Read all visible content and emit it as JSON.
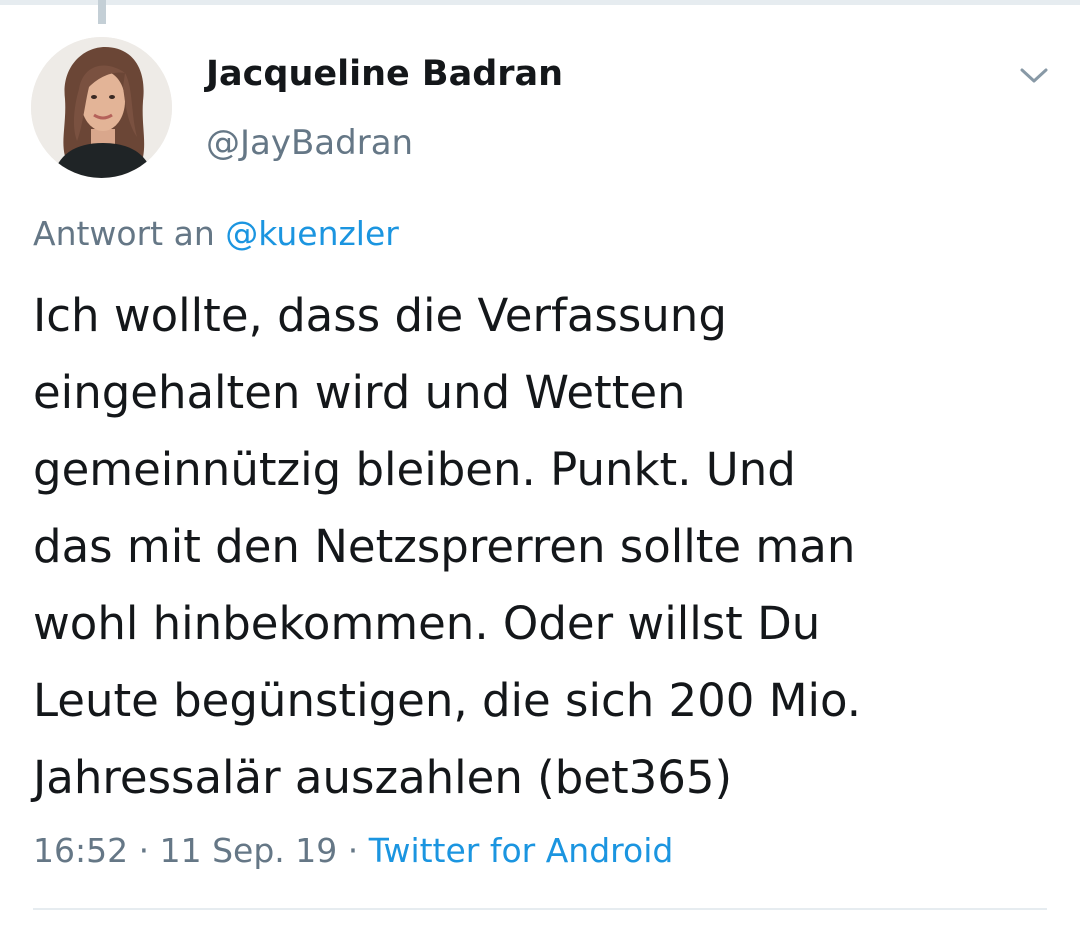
{
  "author": {
    "display_name": "Jacqueline Badran",
    "handle": "@JayBadran"
  },
  "reply": {
    "prefix": "Antwort an",
    "mention": "@kuenzler"
  },
  "tweet": {
    "lines": [
      "Ich wollte, dass die Verfassung",
      "eingehalten wird und Wetten",
      "gemeinnützig bleiben. Punkt. Und",
      "das mit den Netzsprerren sollte man",
      "wohl hinbekommen. Oder willst Du",
      "Leute begünstigen, die sich 200 Mio.",
      "Jahressalär auszahlen (bet365)"
    ]
  },
  "meta": {
    "time": "16:52",
    "separator_1": "·",
    "date": "11 Sep. 19",
    "separator_2": "·",
    "source": "Twitter for Android"
  },
  "icons": {
    "menu": "chevron-down-icon",
    "avatar": "profile-photo"
  },
  "colors": {
    "text": "#14171a",
    "secondary": "#657786",
    "link": "#1b95e0",
    "divider": "#e6ecf0"
  }
}
